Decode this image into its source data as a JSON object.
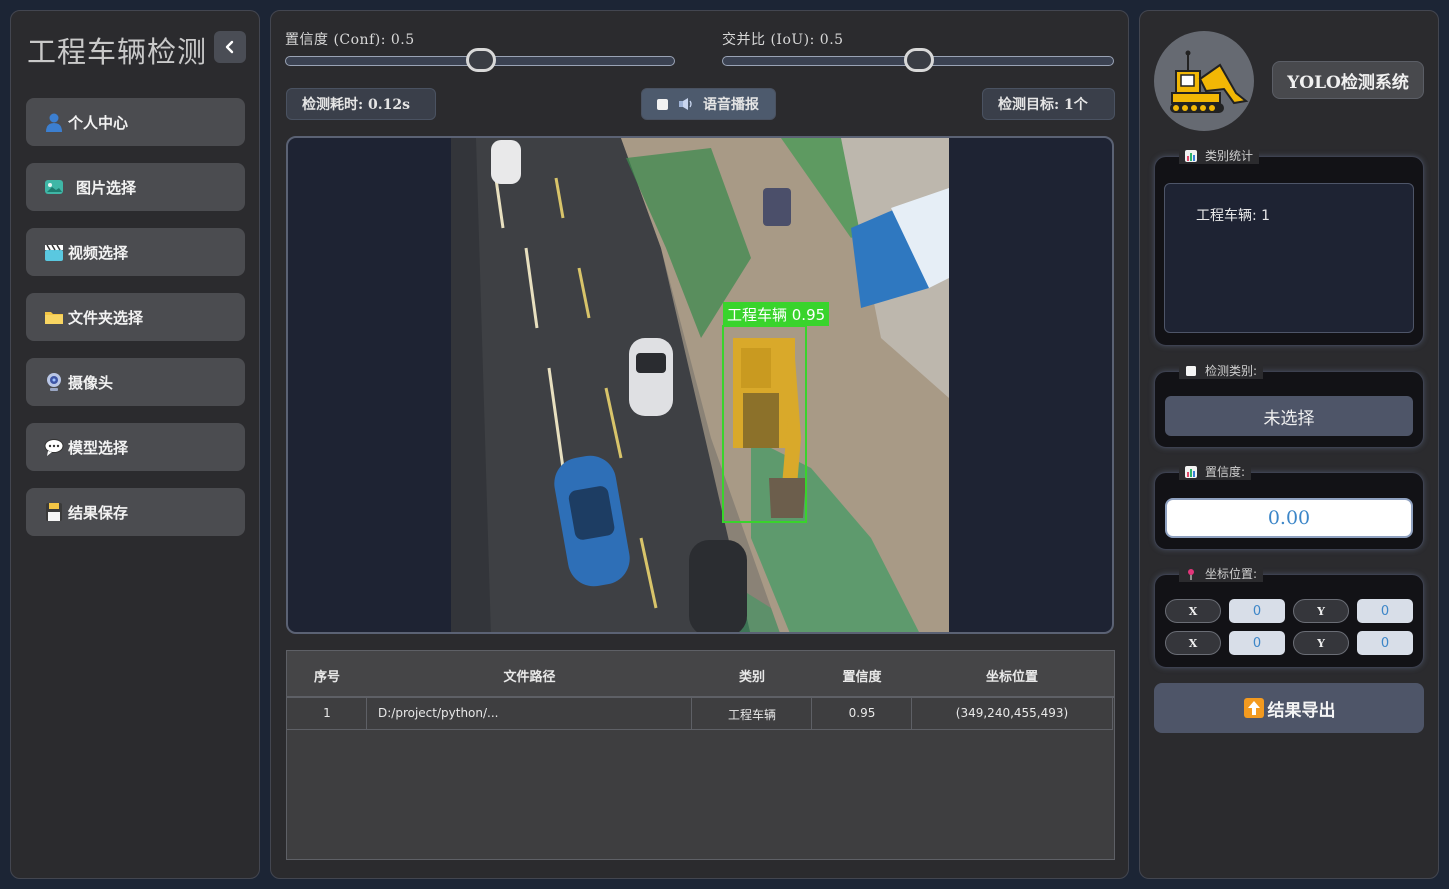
{
  "sidebar": {
    "title": "工程车辆检测",
    "items": [
      {
        "label": "个人中心",
        "icon": "person-icon"
      },
      {
        "label": "图片选择",
        "icon": "image-icon"
      },
      {
        "label": "视频选择",
        "icon": "clapper-icon"
      },
      {
        "label": "文件夹选择",
        "icon": "folder-icon"
      },
      {
        "label": "摄像头",
        "icon": "webcam-icon"
      },
      {
        "label": "模型选择",
        "icon": "speech-bubble-icon"
      },
      {
        "label": "结果保存",
        "icon": "floppy-disk-icon"
      }
    ]
  },
  "controls": {
    "conf_label": "置信度 (Conf): 0.5",
    "conf_value": 0.5,
    "iou_label": "交并比 (IoU): 0.5",
    "iou_value": 0.5,
    "time_label": "检测耗时: 0.12s",
    "voice_label": "语音播报",
    "target_label": "检测目标: 1个"
  },
  "viewer": {
    "detection_label": "工程车辆 0.95"
  },
  "table": {
    "headers": [
      "序号",
      "文件路径",
      "类别",
      "置信度",
      "坐标位置"
    ],
    "rows": [
      {
        "index": "1",
        "path": "D:/project/python/...",
        "class": "工程车辆",
        "conf": "0.95",
        "coords": "(349,240,455,493)"
      }
    ]
  },
  "right": {
    "system_title": "YOLO检测系统",
    "stats_legend": "类别统计",
    "stats_text": "工程车辆: 1",
    "class_legend": "检测类别:",
    "class_value": "未选择",
    "conf_legend": "置信度:",
    "conf_value": "0.00",
    "coord_legend": "坐标位置:",
    "coord_labels": [
      "X",
      "Y",
      "X",
      "Y"
    ],
    "coord_values": [
      "0",
      "0",
      "0",
      "0"
    ],
    "export_label": "结果导出"
  },
  "colors": {
    "detection_box": "#39d42c",
    "accent_blue": "#3c86c8"
  }
}
